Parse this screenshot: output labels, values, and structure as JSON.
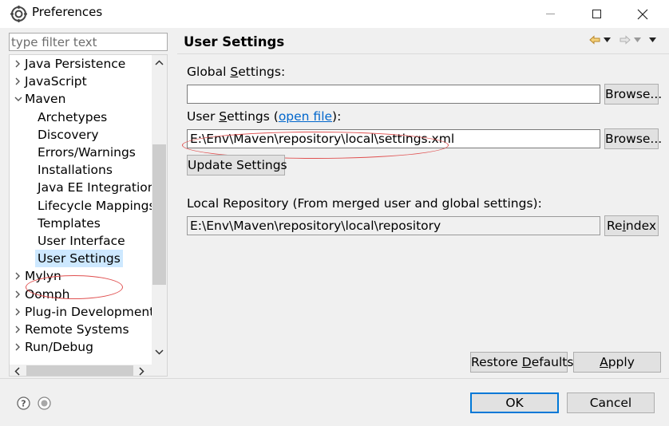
{
  "window": {
    "title": "Preferences"
  },
  "filter": {
    "placeholder": "type filter text"
  },
  "tree": {
    "items": [
      {
        "label": "Java Persistence",
        "level": 0,
        "expanded": false
      },
      {
        "label": "JavaScript",
        "level": 0,
        "expanded": false
      },
      {
        "label": "Maven",
        "level": 0,
        "expanded": true
      },
      {
        "label": "Archetypes",
        "level": 1
      },
      {
        "label": "Discovery",
        "level": 1
      },
      {
        "label": "Errors/Warnings",
        "level": 1
      },
      {
        "label": "Installations",
        "level": 1
      },
      {
        "label": "Java EE Integration",
        "level": 1
      },
      {
        "label": "Lifecycle Mappings",
        "level": 1
      },
      {
        "label": "Templates",
        "level": 1
      },
      {
        "label": "User Interface",
        "level": 1
      },
      {
        "label": "User Settings",
        "level": 1,
        "selected": true
      },
      {
        "label": "Mylyn",
        "level": 0,
        "expanded": false
      },
      {
        "label": "Oomph",
        "level": 0,
        "expanded": false
      },
      {
        "label": "Plug-in Development",
        "level": 0,
        "expanded": false
      },
      {
        "label": "Remote Systems",
        "level": 0,
        "expanded": false
      },
      {
        "label": "Run/Debug",
        "level": 0,
        "expanded": false
      }
    ]
  },
  "page": {
    "title": "User Settings",
    "global_settings": {
      "label_pre": "Global ",
      "label_key": "S",
      "label_post": "ettings:",
      "value": "",
      "browse_label": "Browse..."
    },
    "user_settings": {
      "label_pre": "User ",
      "label_key": "S",
      "label_mid": "ettings (",
      "link_text": "open file",
      "label_post": "):",
      "value": "E:\\Env\\Maven\\repository\\local\\settings.xml",
      "browse_label": "Browse..."
    },
    "update_settings_label": "Update Settings",
    "local_repo": {
      "label": "Local Repository (From merged user and global settings):",
      "value": "E:\\Env\\Maven\\repository\\local\\repository",
      "reindex_pre": "Re",
      "reindex_key": "i",
      "reindex_post": "ndex"
    },
    "restore_defaults_pre": "Restore ",
    "restore_defaults_key": "D",
    "restore_defaults_post": "efaults",
    "apply_key": "A",
    "apply_post": "pply"
  },
  "footer": {
    "ok_label": "OK",
    "cancel_label": "Cancel"
  },
  "colors": {
    "selection": "#cde8ff",
    "link": "#0066cc",
    "annotation": "#e05050",
    "default_button_border": "#0078d7"
  }
}
